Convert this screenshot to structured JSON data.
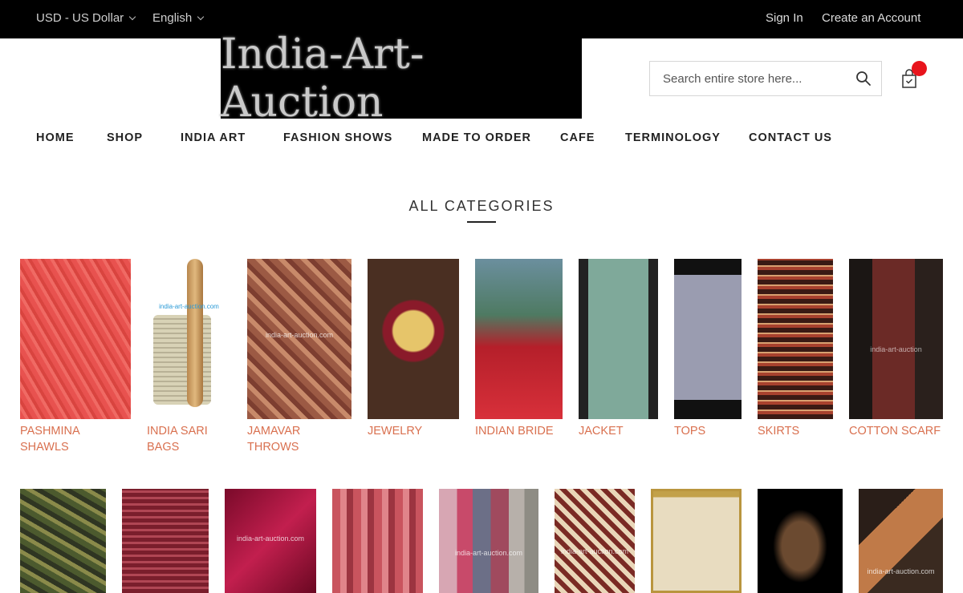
{
  "topbar": {
    "currency": "USD - US Dollar",
    "language": "English",
    "sign_in": "Sign In",
    "create_account": "Create an Account"
  },
  "logo": {
    "text": "India-Art-Auction"
  },
  "search": {
    "placeholder": "Search entire store here..."
  },
  "nav": [
    "HOME",
    "SHOP",
    "INDIA ART",
    "FASHION SHOWS",
    "MADE TO ORDER",
    "CAFE",
    "TERMINOLOGY",
    "CONTACT US"
  ],
  "section_title": "ALL CATEGORIES",
  "categories_row1": [
    {
      "label_line1": "PASHMINA",
      "label_line2": "SHAWLS"
    },
    {
      "label_line1": "INDIA SARI",
      "label_line2": "BAGS",
      "watermark": "india-art-auction.com"
    },
    {
      "label_line1": "JAMAVAR",
      "label_line2": "THROWS",
      "watermark": "india-art-auction.com"
    },
    {
      "label_line1": "JEWELRY"
    },
    {
      "label_line1": "INDIAN BRIDE"
    },
    {
      "label_line1": "JACKET"
    },
    {
      "label_line1": "TOPS"
    },
    {
      "label_line1": "SKIRTS"
    },
    {
      "label_line1": "COTTON SCARF",
      "watermark": "india-art-auction"
    }
  ],
  "categories_row2_watermarks": {
    "satin": "india-art-auction.com",
    "cashmere": "india-art-auction.com",
    "rug": "india-art-auction.com",
    "painting": "india-art-auction.com"
  },
  "colors": {
    "topbar_bg": "#000000",
    "category_label": "#d9704f",
    "cart_badge": "#e8141c"
  }
}
